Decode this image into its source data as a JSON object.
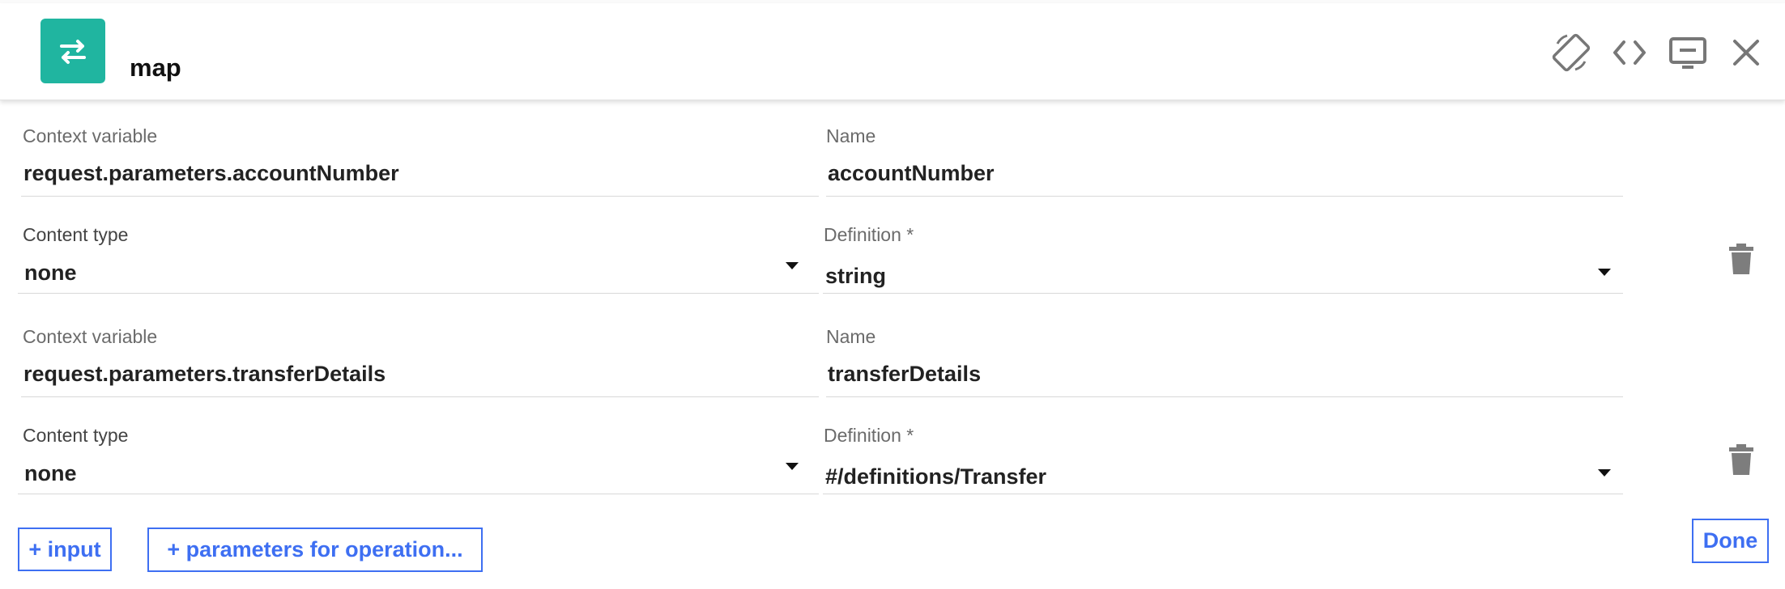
{
  "header": {
    "title": "map",
    "icons": {
      "app": "swap-arrows-icon",
      "rotate": "screen-rotation-icon",
      "code": "code-icon",
      "display": "monitor-icon",
      "close": "close-icon"
    }
  },
  "mappings": [
    {
      "context_label": "Context variable",
      "context_value": "request.parameters.accountNumber",
      "name_label": "Name",
      "name_value": "accountNumber",
      "content_type_label": "Content type",
      "content_type_value": "none",
      "definition_label": "Definition *",
      "definition_value": "string"
    },
    {
      "context_label": "Context variable",
      "context_value": "request.parameters.transferDetails",
      "name_label": "Name",
      "name_value": "transferDetails",
      "content_type_label": "Content type",
      "content_type_value": "none",
      "definition_label": "Definition *",
      "definition_value": "#/definitions/Transfer"
    }
  ],
  "actions": {
    "add_input": "+ input",
    "add_parameters": "+ parameters for operation...",
    "done": "Done"
  },
  "colors": {
    "accent": "#3e6ff2",
    "app_icon_bg": "#20b5a0"
  }
}
